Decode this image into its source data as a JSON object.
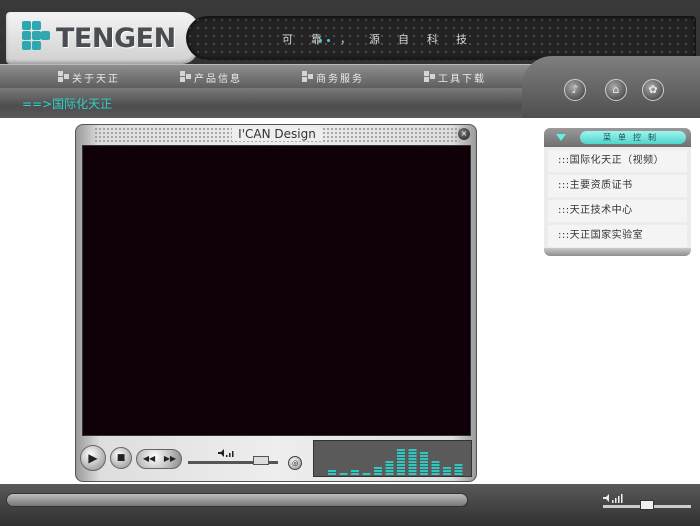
{
  "brand": {
    "name": "TENGEN",
    "slogan": "可靠，源自科技"
  },
  "nav": {
    "items": [
      {
        "label": "关于天正"
      },
      {
        "label": "产品信息"
      },
      {
        "label": "商务服务"
      },
      {
        "label": "工具下载"
      }
    ]
  },
  "breadcrumb": {
    "text": "==>国际化天正"
  },
  "header_buttons": {
    "music": "♪",
    "home": "⌂",
    "settings": "✿"
  },
  "player": {
    "title": "I'CAN Design",
    "close": "×",
    "play": "▶",
    "stop": "■",
    "rewind": "◀◀",
    "forward": "▶▶",
    "mini": "◎",
    "eq_levels": [
      0.18,
      0.1,
      0.22,
      0.12,
      0.3,
      0.42,
      0.82,
      0.78,
      0.72,
      0.45,
      0.3,
      0.38
    ],
    "eq_color": "#2fc7c0"
  },
  "menu": {
    "title": "菜单控制",
    "items": [
      {
        "label": ":::国际化天正（视频）"
      },
      {
        "label": ":::主要资质证书"
      },
      {
        "label": ":::天正技术中心"
      },
      {
        "label": ":::天正国家实验室"
      }
    ]
  },
  "colors": {
    "accent": "#2fd0c8",
    "video_bg": "#0f000a"
  }
}
